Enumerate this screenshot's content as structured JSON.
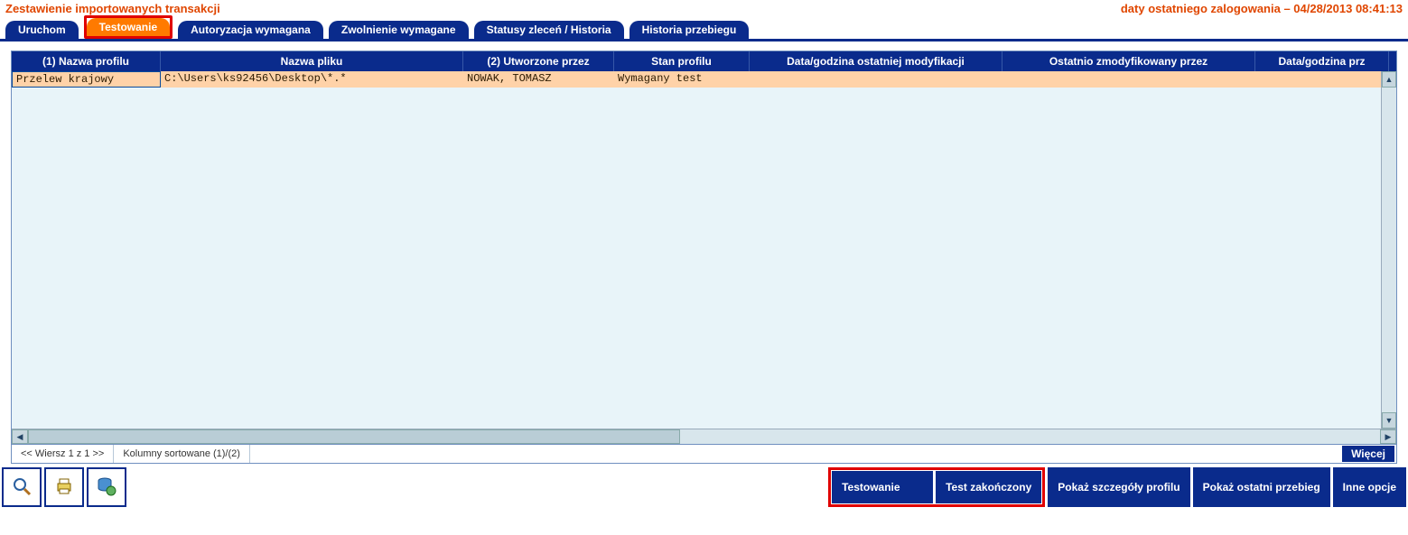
{
  "header": {
    "title": "Zestawienie importowanych transakcji",
    "login_label": "daty ostatniego zalogowania –  04/28/2013 08:41:13"
  },
  "tabs": [
    {
      "id": "uruchom",
      "label": "Uruchom",
      "active": false
    },
    {
      "id": "testowanie",
      "label": "Testowanie",
      "active": true,
      "highlighted": true
    },
    {
      "id": "autoryzacja",
      "label": "Autoryzacja wymagana",
      "active": false
    },
    {
      "id": "zwolnienie",
      "label": "Zwolnienie wymagane",
      "active": false
    },
    {
      "id": "statusy",
      "label": "Statusy zleceń / Historia",
      "active": false
    },
    {
      "id": "historia",
      "label": "Historia przebiegu",
      "active": false
    }
  ],
  "table": {
    "columns": [
      "(1) Nazwa profilu",
      "Nazwa pliku",
      "(2) Utworzone przez",
      "Stan profilu",
      "Data/godzina ostatniej modyfikacji",
      "Ostatnio zmodyfikowany przez",
      "Data/godzina prz"
    ],
    "rows": [
      {
        "nazwa_profilu": "Przelew krajowy",
        "nazwa_pliku": "C:\\Users\\ks92456\\Desktop\\*.*",
        "utworzone_przez": "NOWAK, TOMASZ",
        "stan_profilu": "Wymagany test",
        "data_mod": "",
        "zmod_przez": "",
        "data_prz": ""
      }
    ]
  },
  "status": {
    "row_info": "<< Wiersz 1 z 1 >>",
    "sort_info": "Kolumny sortowane (1)/(2)",
    "more_label": "Więcej"
  },
  "toolbar_icons": {
    "search": "search-icon",
    "print": "print-icon",
    "db": "database-globe-icon"
  },
  "actions": {
    "testowanie": "Testowanie",
    "test_zak": "Test zakończony",
    "pokaz_szcz": "Pokaż szczegóły profilu",
    "pokaz_ost": "Pokaż ostatni przebieg",
    "inne": "Inne opcje"
  }
}
